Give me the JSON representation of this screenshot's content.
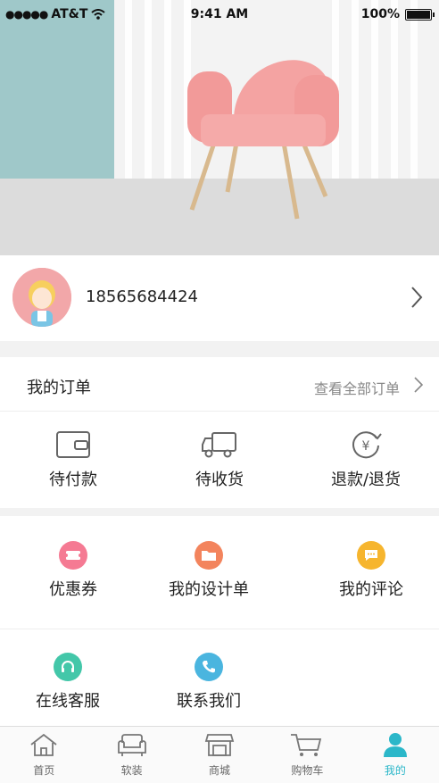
{
  "status_bar": {
    "carrier": "AT&T",
    "time": "9:41 AM",
    "battery": "100%"
  },
  "profile": {
    "phone": "18565684424"
  },
  "orders": {
    "title": "我的订单",
    "view_all": "查看全部订单",
    "items": [
      {
        "label": "待付款",
        "icon": "wallet-icon"
      },
      {
        "label": "待收货",
        "icon": "truck-icon"
      },
      {
        "label": "退款/退货",
        "icon": "refund-icon"
      }
    ]
  },
  "services": [
    {
      "label": "优惠券",
      "icon": "coupon-icon",
      "color": "#f57a93"
    },
    {
      "label": "我的设计单",
      "icon": "folder-icon",
      "color": "#f3845d"
    },
    {
      "label": "我的评论",
      "icon": "comment-icon",
      "color": "#f6b52e"
    },
    {
      "label": "在线客服",
      "icon": "headset-icon",
      "color": "#43c7a9"
    },
    {
      "label": "联系我们",
      "icon": "phone-icon",
      "color": "#4ab5df"
    }
  ],
  "tabbar": {
    "items": [
      {
        "label": "首页",
        "icon": "home-icon"
      },
      {
        "label": "软装",
        "icon": "sofa-icon"
      },
      {
        "label": "商城",
        "icon": "store-icon"
      },
      {
        "label": "购物车",
        "icon": "cart-icon"
      },
      {
        "label": "我的",
        "icon": "user-icon"
      }
    ],
    "active_index": 4,
    "active_color": "#2bb7c9"
  }
}
